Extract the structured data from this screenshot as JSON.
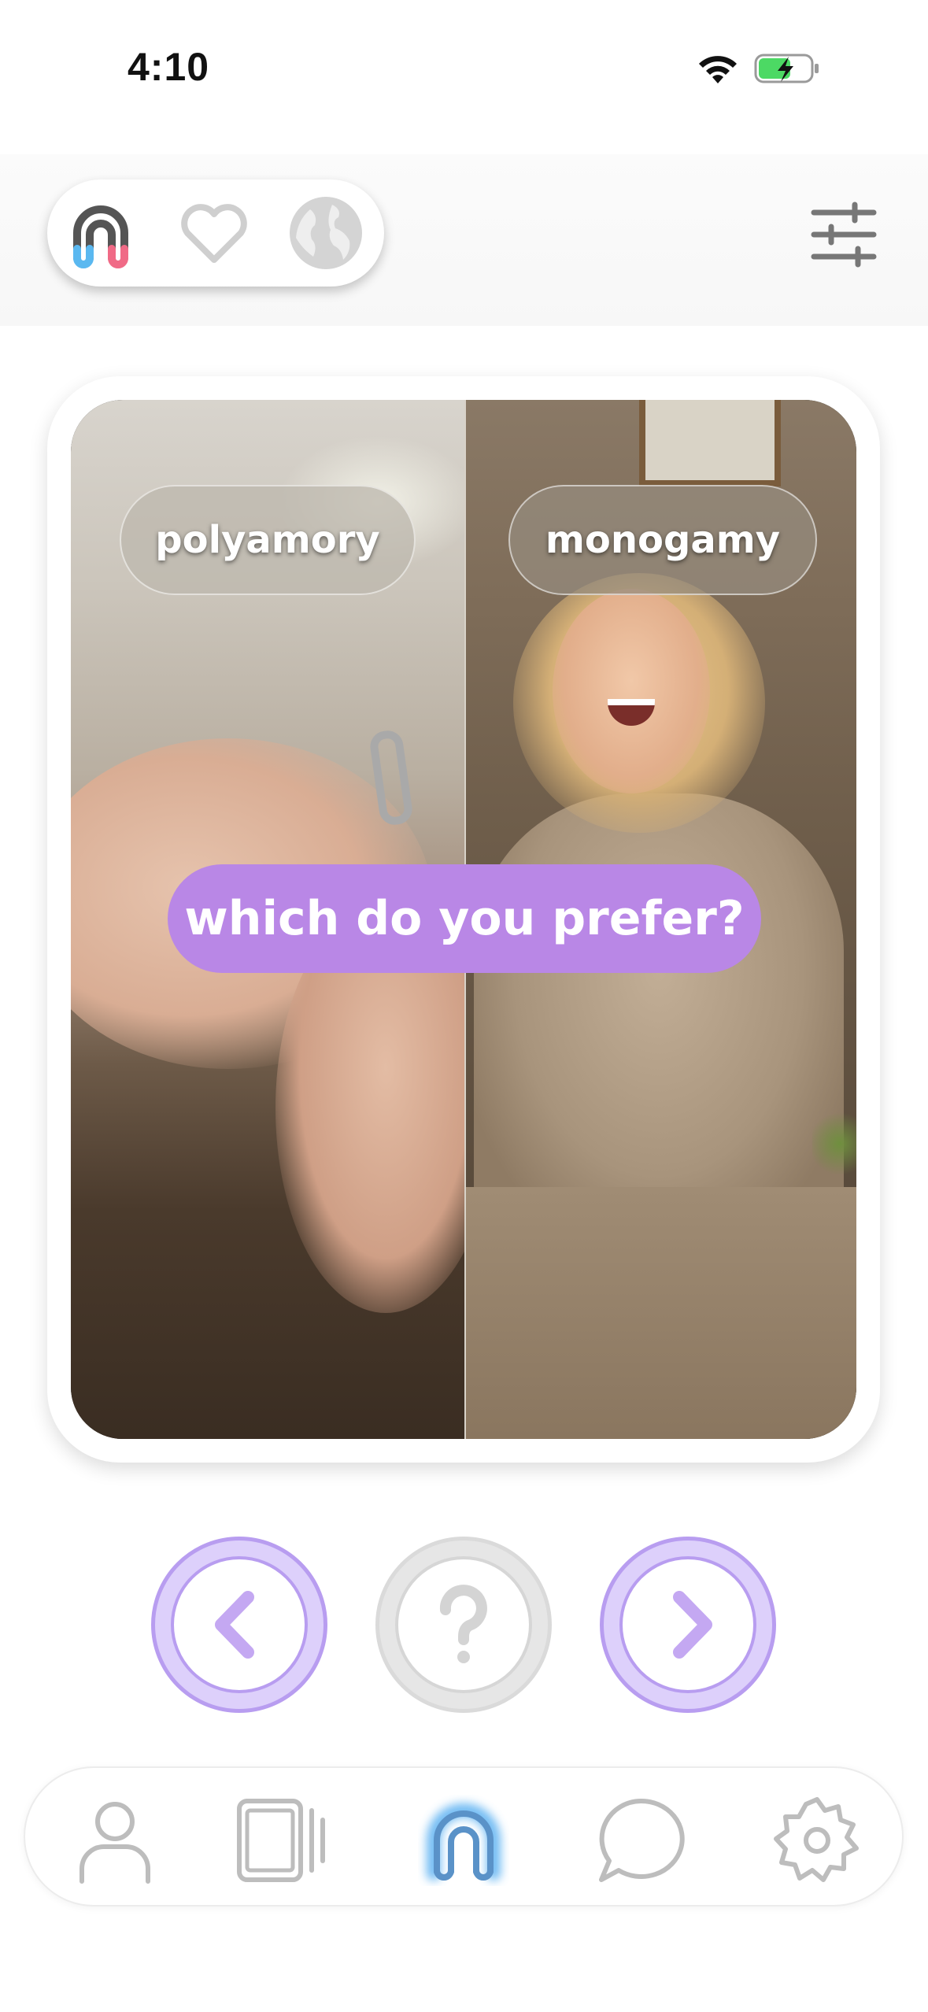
{
  "status_bar": {
    "time": "4:10",
    "icons": [
      "wifi-icon",
      "battery-charging-icon"
    ],
    "battery_color": "#4cd964"
  },
  "header": {
    "modes": [
      {
        "icon": "app-logo-icon",
        "selected": true
      },
      {
        "icon": "heart-icon",
        "selected": false
      },
      {
        "icon": "globe-icon",
        "selected": false
      }
    ],
    "filter_icon": "sliders-icon"
  },
  "card": {
    "left_option": "polyamory",
    "right_option": "monogamy",
    "prompt": "which do you prefer?",
    "prompt_color": "#b987e6"
  },
  "actions": {
    "prev_icon": "chevron-left-icon",
    "help_icon": "question-icon",
    "next_icon": "chevron-right-icon",
    "accent_color": "#b89df0"
  },
  "bottom_nav": {
    "items": [
      {
        "icon": "profile-icon",
        "active": false
      },
      {
        "icon": "video-cards-icon",
        "active": false
      },
      {
        "icon": "app-logo-icon",
        "active": true
      },
      {
        "icon": "chat-bubble-icon",
        "active": false
      },
      {
        "icon": "settings-gear-icon",
        "active": false
      }
    ]
  }
}
